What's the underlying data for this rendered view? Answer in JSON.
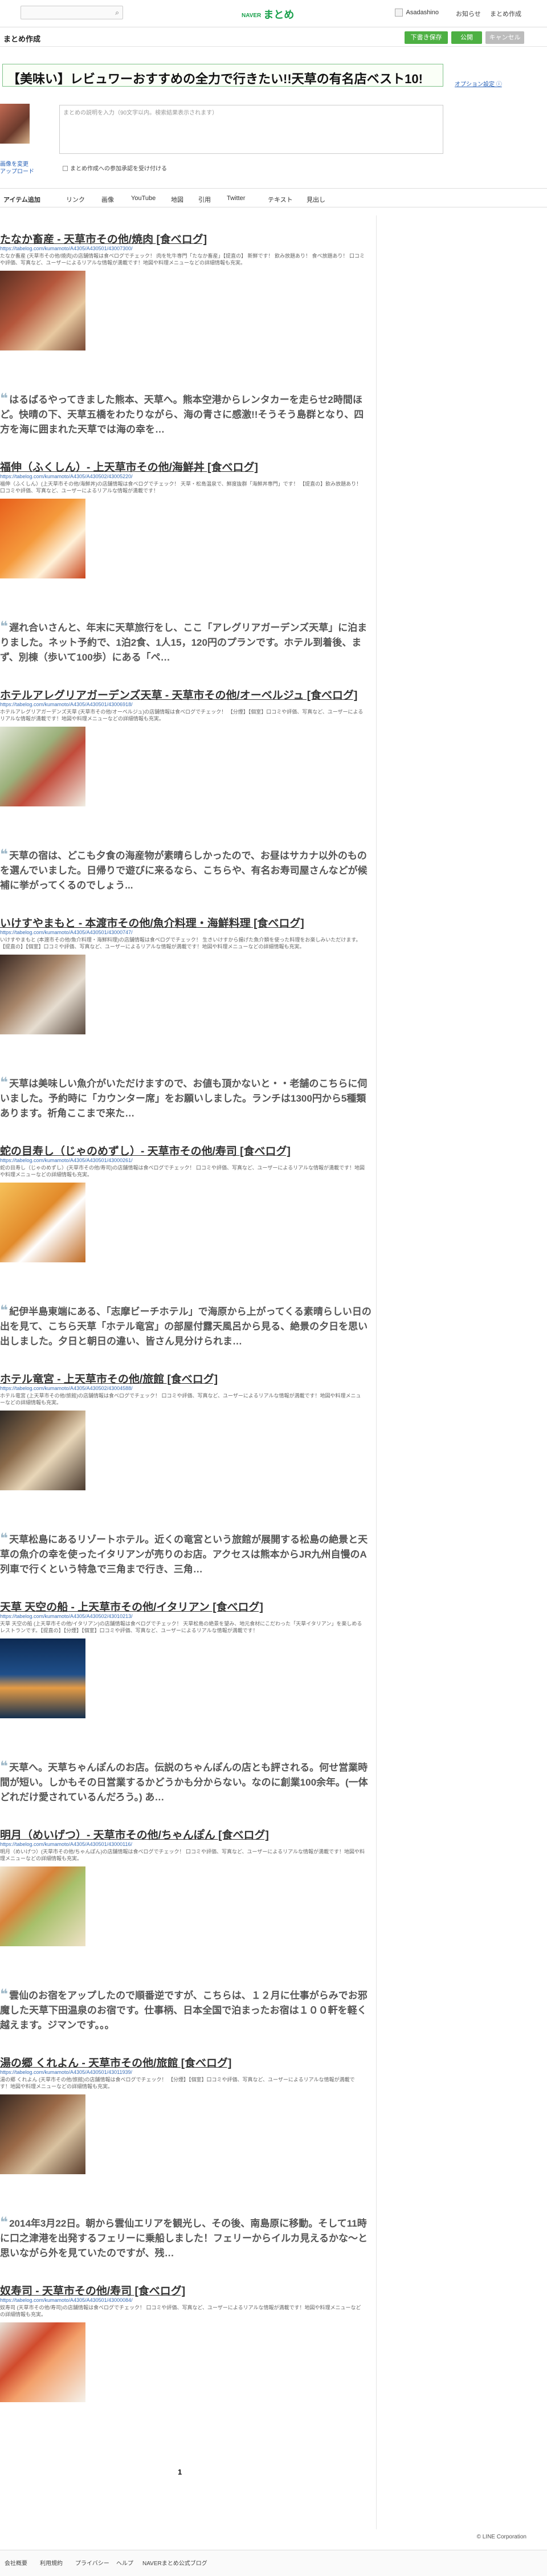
{
  "header": {
    "logo_prefix": "NAVER",
    "logo": "まとめ",
    "search_icon": "search-icon",
    "username": "Asadashino",
    "links": [
      "お知らせ",
      "まとめ作成"
    ]
  },
  "editor": {
    "heading": "まとめ作成",
    "buttons": {
      "draft": "下書き保存",
      "publish": "公開",
      "cancel": "キャンセル"
    },
    "title": "【美味い】レビュワーおすすめの全力で行きたい!!天草の有名店ベスト10!",
    "option_link": "オプション設定 ⓘ",
    "thumbnail_change": "画像を変更\nアップロード",
    "description_placeholder": "まとめの説明を入力（90文字以内。検索結果表示されます）",
    "notify_label": "まとめ作成への参加承認を受け付ける"
  },
  "toolbar": {
    "items": [
      "アイテム追加",
      "リンク",
      "画像",
      "YouTube",
      "地図",
      "引用",
      "Twitter",
      "テキスト",
      "見出し"
    ]
  },
  "items": [
    {
      "title": "たなか畜産 - 天草市その他/焼肉 [食べログ]",
      "url": "https://tabelog.com/kumamoto/A4305/A430501/43007300/",
      "desc": "たなか畜産 (天草市その他/焼肉)の店舗情報は食べログでチェック！ 肉を牝牛専門「たなか畜産」【提直の】 新鮮です！ 飲み放題あり！ 食べ放題あり！ 口コミや評価、写真など、ユーザーによるリアルな情報が満載です！地図や料理メニューなどの詳細情報も充実。",
      "photo": "grilled-meat-photo",
      "quote": "はるばるやってきました熊本、天草へ。熊本空港からレンタカーを走らせ2時間ほど。快晴の下、天草五橋をわたりながら、海の青さに感激!!そうそう島群となり、四方を海に囲まれた天草では海の幸を…"
    },
    {
      "title": "福伸（ふくしん）- 上天草市その他/海鮮丼 [食べログ]",
      "url": "https://tabelog.com/kumamoto/A4305/A430502/43005220/",
      "desc": "福伸（ふくしん）(上天草市その他/海鮮丼)の店舗情報は食べログでチェック！ 天草・松島温泉で、鮮度抜群「海鮮丼専門」です！ 【提直の】飲み放題あり！ 口コミや評価、写真など、ユーザーによるリアルな情報が満載です！",
      "photo": "seafood-bowl-photo",
      "quote": "遅れ合いさんと、年末に天草旅行をし、ここ「アレグリアガーデンズ天草」に泊まりました。ネット予約で、1泊2食、1人15，120円のプランです。ホテル到着後、まず、別棟（歩いて100歩）にある「ペ…"
    },
    {
      "title": "ホテルアレグリアガーデンズ天草 - 天草市その他/オーベルジュ [食べログ]",
      "url": "https://tabelog.com/kumamoto/A4305/A430501/43006918/",
      "desc": "ホテルアレグリアガーデンズ天草 (天草市その他/オーベルジュ)の店舗情報は食べログでチェック！ 【分煙】【個室】口コミや評価、写真など、ユーザーによるリアルな情報が満載です！地図や料理メニューなどの詳細情報も充実。",
      "photo": "course-dinner-photo",
      "quote": "天草の宿は、どこも夕食の海産物が素晴らしかったので、お昼はサカナ以外のものを選んでいました。日帰りで遊びに来るなら、こちらや、有名お寿司屋さんなどが候補に挙がってくるのでしょう..."
    },
    {
      "title": "いけすやまもと - 本渡市その他/魚介料理・海鮮料理 [食べログ]",
      "url": "https://tabelog.com/kumamoto/A4305/A430501/43000747/",
      "desc": "いけすやまもと (本渡市その他/魚介料理・海鮮料理)の店舗情報は食べログでチェック！ 生きいけすから揚げた魚介類を使った料理をお楽しみいただけます。【提直の】【個室】口コミや評価、写真など、ユーザーによるリアルな情報が満載です！地図や料理メニューなどの詳細情報も充実。",
      "photo": "set-meal-photo",
      "quote": "天草は美味しい魚介がいただけますので、お値も頂かないと・・老舗のこちらに伺いました。予約時に「カウンター席」をお願いしました。ランチは1300円から5種類あります。祈角ここまで来た…"
    },
    {
      "title": "蛇の目寿し（じゃのめずし）- 天草市その他/寿司 [食べログ]",
      "url": "https://tabelog.com/kumamoto/A4305/A430501/43000261/",
      "desc": "蛇の目寿し（じゃのめずし）(天草市その他/寿司)の店舗情報は食べログでチェック！ 口コミや評価、写真など、ユーザーによるリアルな情報が満載です！地図や料理メニューなどの詳細情報も充実。",
      "photo": "sushi-photo",
      "quote": "紀伊半島東端にある、「志摩ビーチホテル」で海原から上がってくる素晴らしい日の出を見て、こちら天草「ホテル竜宮」の部屋付露天風呂から見る、絶景の夕日を思い出しました。夕日と朝日の違い、皆さん見分けられま…"
    },
    {
      "title": "ホテル竜宮 - 上天草市その他/旅館 [食べログ]",
      "url": "https://tabelog.com/kumamoto/A4305/A430502/43004588/",
      "desc": "ホテル竜宮 (上天草市その他/旅館)の店舗情報は食べログでチェック！ 口コミや評価、写真など、ユーザーによるリアルな情報が満載です！地図や料理メニューなどの詳細情報も充実。",
      "photo": "ryokan-dinner-photo",
      "quote": "天草松島にあるリゾートホテル。近くの竜宮という旅館が展開する松島の絶景と天草の魚介の幸を使ったイタリアンが売りのお店。アクセスは熊本からJR九州自慢のA列車で行くという特急で三角まで行き、三角…"
    },
    {
      "title": "天草 天空の船 - 上天草市その他/イタリアン [食べログ]",
      "url": "https://tabelog.com/kumamoto/A4305/A430502/43010213/",
      "desc": "天草 天空の船 (上天草市その他/イタリアン)の店舗情報は食べログでチェック！ 天草松島の絶景を望み、地元食材にこだわった「天草イタリアン」を楽しめるレストランです。【提直の】【分煙】【個室】口コミや評価、写真など、ユーザーによるリアルな情報が満載です！",
      "photo": "sea-view-photo",
      "quote": "天草へ。天草ちゃんぽんのお店。伝説のちゃんぽんの店とも評される。何せ営業時間が短い。しかもその日営業するかどうかも分からない。なのに創業100余年。(一体どれだけ愛されているんだろう。) あ…"
    },
    {
      "title": "明月（めいげつ）- 天草市その他/ちゃんぽん [食べログ]",
      "url": "https://tabelog.com/kumamoto/A4305/A430501/43000116/",
      "desc": "明月（めいげつ）(天草市その他/ちゃんぽん)の店舗情報は食べログでチェック！ 口コミや評価、写真など、ユーザーによるリアルな情報が満載です！地図や料理メニューなどの詳細情報も充実。",
      "photo": "champon-photo",
      "quote": "雲仙のお宿をアップしたので順番逆ですが、こちらは、１２月に仕事がらみでお邪魔した天草下田温泉のお宿です。仕事柄、日本全国で泊まったお宿は１００軒を軽く越えます。ジマンです。。。"
    },
    {
      "title": "湯の郷 くれよん - 天草市その他/旅館 [食べログ]",
      "url": "https://tabelog.com/kumamoto/A4305/A430501/43011939/",
      "desc": "湯の郷 くれよん (天草市その他/旅館)の店舗情報は食べログでチェック！ 【分煙】【個室】口コミや評価、写真など、ユーザーによるリアルな情報が満載です！地図や料理メニューなどの詳細情報も充実。",
      "photo": "onsen-meal-photo",
      "quote": "2014年3月22日。朝から雲仙エリアを観光し、その後、南島原に移動。そして11時に口之津港を出発するフェリーに乗船しました！フェリーからイルカ見えるかな～と思いながら外を見ていたのですが、残…"
    },
    {
      "title": "奴寿司 - 天草市その他/寿司 [食べログ]",
      "url": "https://tabelog.com/kumamoto/A4305/A430501/43000084/",
      "desc": "奴寿司 (天草市その他/寿司)の店舗情報は食べログでチェック！ 口コミや評価、写真など、ユーザーによるリアルな情報が満載です！地図や料理メニューなどの詳細情報も充実。",
      "photo": "nigiri-photo",
      "quote": ""
    }
  ],
  "pager": "1",
  "copyright": "© LINE Corporation",
  "footer": [
    "会社概要",
    "利用規約",
    "プライバシー",
    "ヘルプ",
    "NAVERまとめ公式ブログ"
  ],
  "colors": {
    "accent": "#4db043",
    "link": "#3a6fb8",
    "muted_button": "#bcbcbc"
  }
}
